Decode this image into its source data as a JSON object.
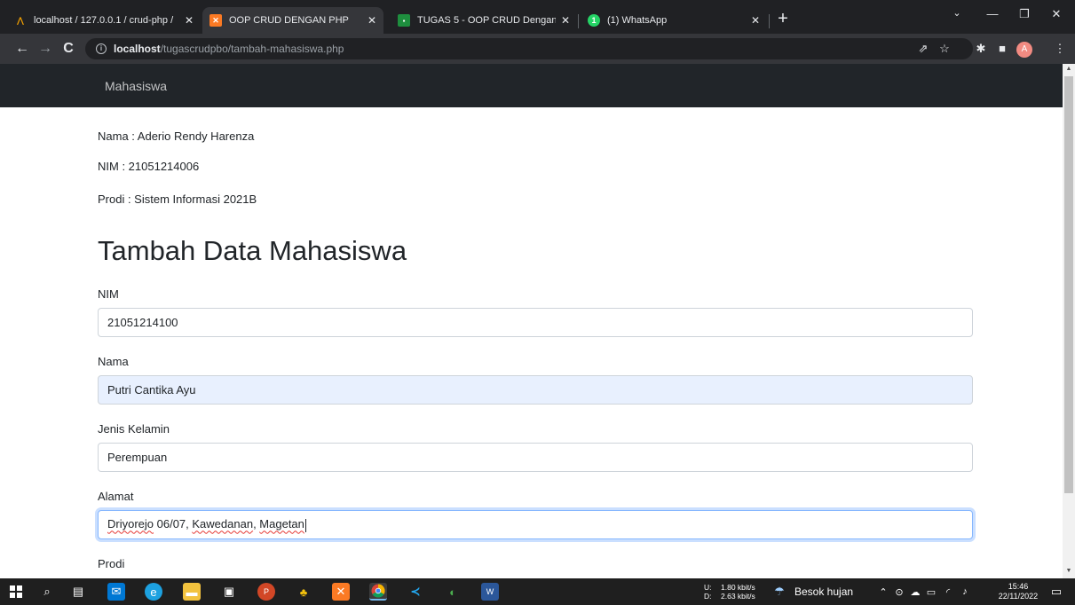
{
  "browser": {
    "tabs": [
      {
        "label": "localhost / 127.0.0.1 / crud-php /",
        "favicon": "phpmyadmin-icon",
        "active": false
      },
      {
        "label": "OOP CRUD DENGAN PHP",
        "favicon": "xampp-icon",
        "active": true
      },
      {
        "label": "TUGAS 5 - OOP CRUD Dengan P",
        "favicon": "classroom-icon",
        "active": false
      },
      {
        "label": "(1) WhatsApp",
        "favicon": "whatsapp-icon",
        "active": false
      }
    ],
    "tab_badge": "1",
    "url_host": "localhost",
    "url_path": "/tugascrudpbo/tambah-mahasiswa.php",
    "profile_initial": "A"
  },
  "navbar": {
    "brand": "Mahasiswa"
  },
  "student_info": {
    "nama": "Nama : Aderio Rendy Harenza",
    "nim": "NIM : 21051214006",
    "prodi": "Prodi : Sistem Informasi 2021B"
  },
  "page": {
    "title": "Tambah Data Mahasiswa"
  },
  "form": {
    "nim": {
      "label": "NIM",
      "value": "21051214100"
    },
    "nama": {
      "label": "Nama",
      "value": "Putri Cantika Ayu"
    },
    "jenis_kelamin": {
      "label": "Jenis Kelamin",
      "value": "Perempuan"
    },
    "alamat": {
      "label": "Alamat",
      "value_part1": "Driyorejo",
      "value_part2": " 06/07, ",
      "value_part3": "Kawedanan",
      "value_part4": ", ",
      "value_part5": "Magetan"
    },
    "prodi": {
      "label": "Prodi"
    }
  },
  "taskbar": {
    "net_up_label": "U:",
    "net_down_label": "D:",
    "net_up": "1.80 kbit/s",
    "net_down": "2.63 kbit/s",
    "weather": "Besok hujan",
    "time": "15:46",
    "date": "22/11/2022"
  },
  "colors": {
    "navbar_bg": "#212529",
    "autofill_bg": "#e8f0fe",
    "focus_border": "#86b7fe",
    "chrome_dark": "#202124"
  }
}
